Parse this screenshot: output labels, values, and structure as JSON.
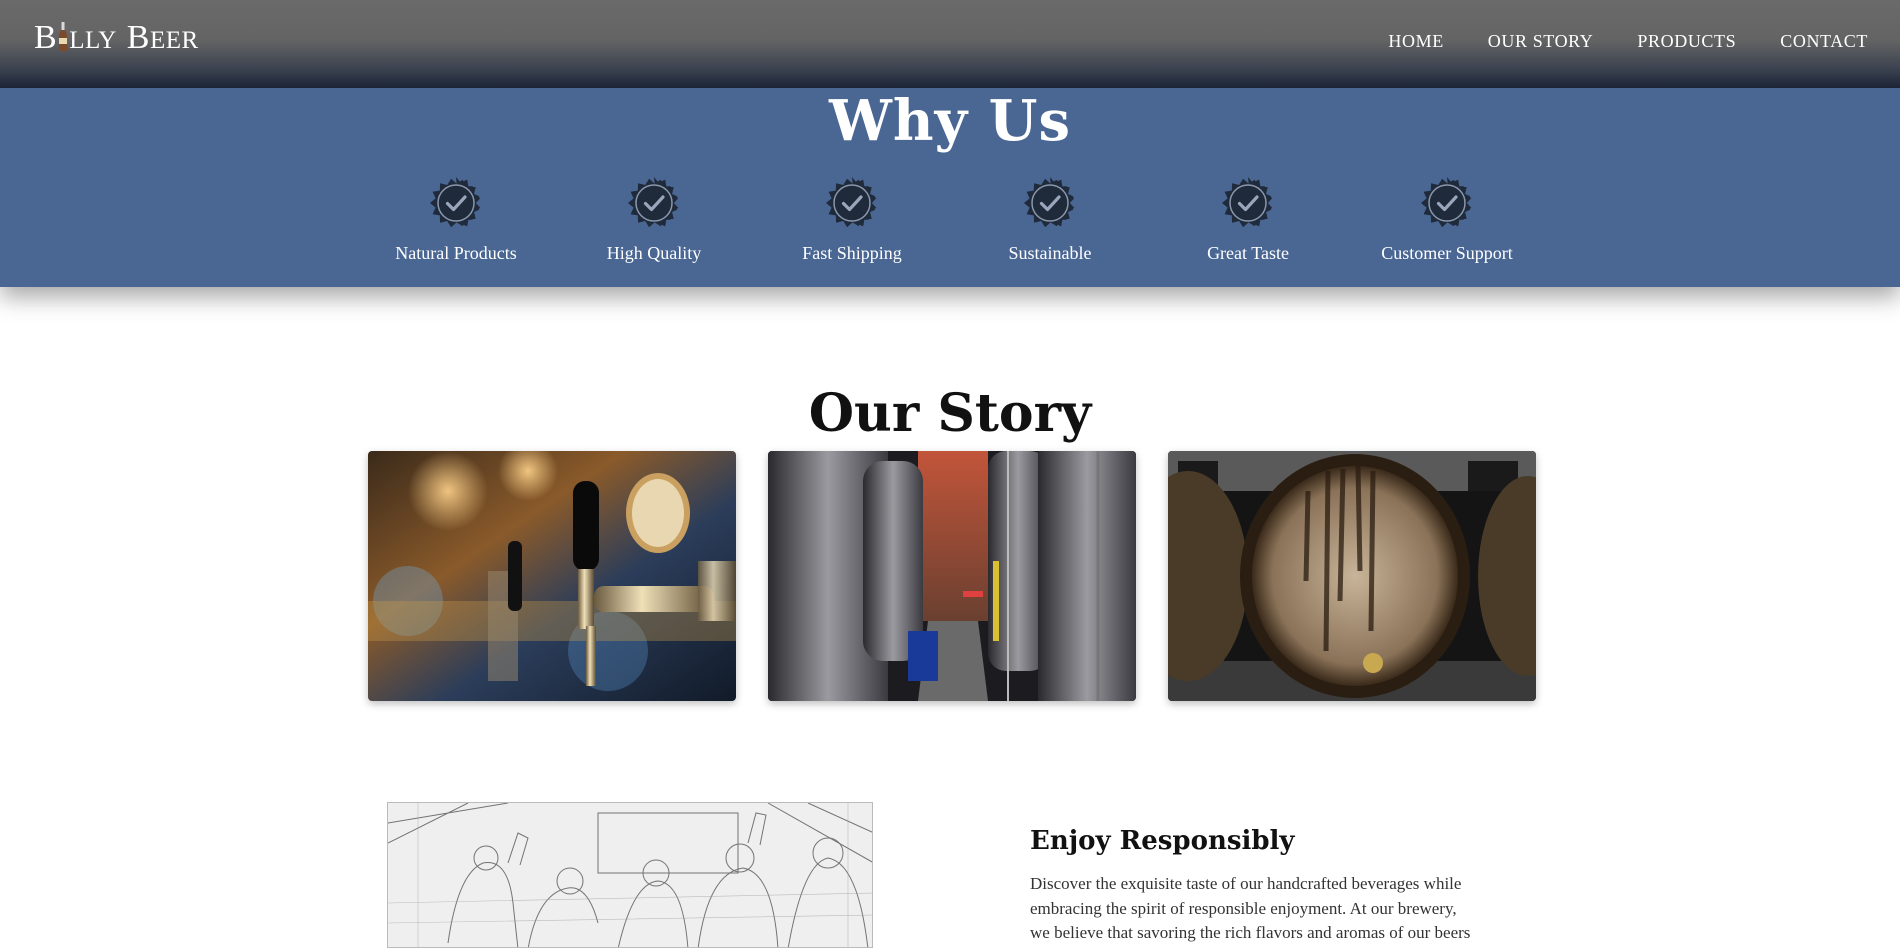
{
  "header": {
    "logo": {
      "first_letter": "B",
      "rest": "LLY",
      "second_initial": "B",
      "second_rest": "EER",
      "alt": "Billy Beer"
    },
    "nav": [
      {
        "label": "HOME"
      },
      {
        "label": "OUR STORY"
      },
      {
        "label": "PRODUCTS"
      },
      {
        "label": "CONTACT"
      }
    ]
  },
  "why_us": {
    "title": "Why Us",
    "features": [
      {
        "label": "Natural Products",
        "icon": "badge-check-icon"
      },
      {
        "label": "High Quality",
        "icon": "badge-check-icon"
      },
      {
        "label": "Fast Shipping",
        "icon": "badge-check-icon"
      },
      {
        "label": "Sustainable",
        "icon": "badge-check-icon"
      },
      {
        "label": "Great Taste",
        "icon": "badge-check-icon"
      },
      {
        "label": "Customer Support",
        "icon": "badge-check-icon"
      }
    ]
  },
  "our_story": {
    "title": "Our Story",
    "photos": [
      {
        "subject": "beer taps"
      },
      {
        "subject": "brewery tanks"
      },
      {
        "subject": "wooden barrel"
      }
    ]
  },
  "enjoy": {
    "title": "Enjoy Responsibly",
    "lines": [
      "Discover the exquisite taste of our handcrafted beverages while",
      "embracing the spirit of responsible enjoyment. At our brewery,",
      "we believe that savoring the rich flavors and aromas of our beers"
    ]
  },
  "colors": {
    "band": "#4a6794",
    "badge": "#1f2a3a",
    "header_dark": "#1b2436"
  }
}
